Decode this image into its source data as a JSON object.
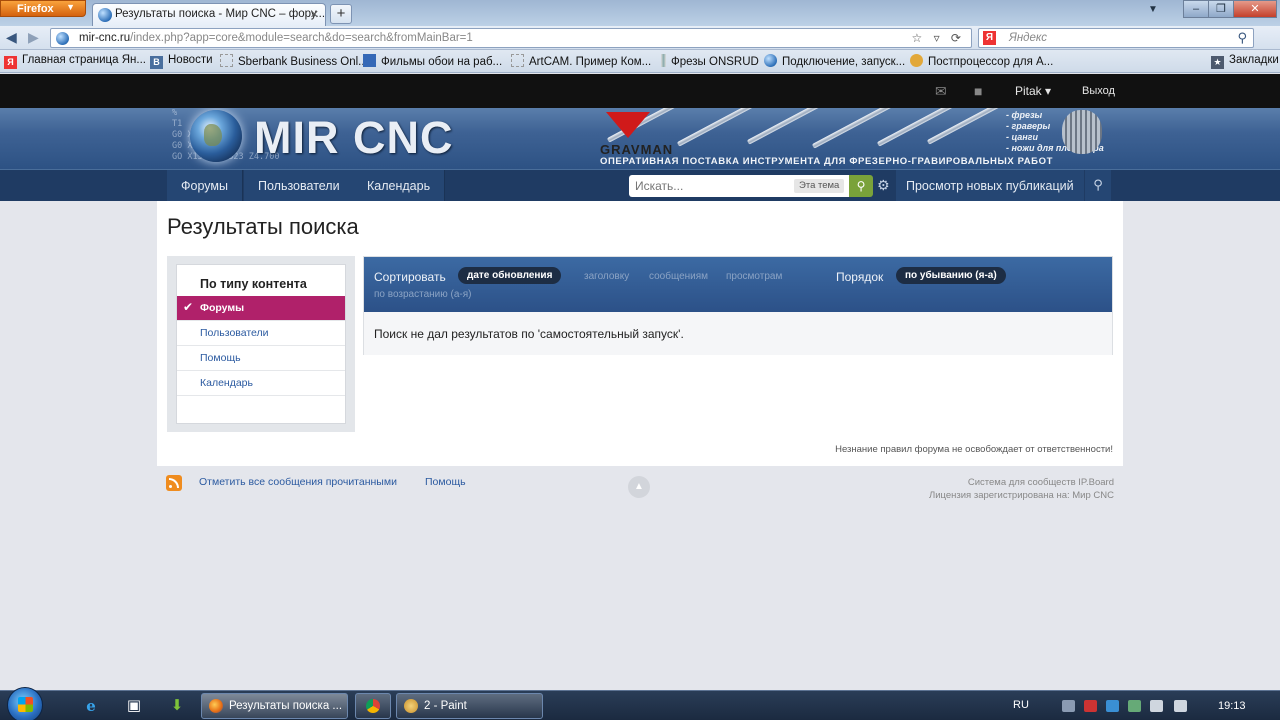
{
  "browser": {
    "firefox_button": "Firefox",
    "tab_title": "Результаты поиска - Мир CNC – фору...",
    "url_host": "mir-cnc.ru",
    "url_rest": "/index.php?app=core&module=search&do=search&fromMainBar=1",
    "search_placeholder": "Яндекс",
    "bookmarks": [
      "Главная страница Ян...",
      "Новости",
      "Sberbank Business Onl...",
      "Фильмы обои на раб...",
      "ArtCAM. Пример Ком...",
      "Фрезы ONSRUD",
      "Подключение, запуск...",
      "Постпроцессор для А..."
    ],
    "bookmarks_menu": "Закладки"
  },
  "site": {
    "user_name": "Pitak",
    "logout": "Выход",
    "logo_text": "MIR CNC",
    "gcode_lines": [
      "%",
      "T1",
      "G0 X0 Y0",
      "G0 X0 Y0",
      "GO X150 Y1.823 Z4.700"
    ],
    "banner_brand": "GRAVMAN",
    "banner_tagline": "ОПЕРАТИВНАЯ ПОСТАВКА ИНСТРУМЕНТА ДЛЯ ФРЕЗЕРНО-ГРАВИРОВАЛЬНЫХ РАБОТ",
    "banner_list": [
      "- фрезы",
      "- граверы",
      "- цанги",
      "- ножи для плоттера"
    ],
    "nav": {
      "forums": "Форумы",
      "users": "Пользователи",
      "calendar": "Календарь",
      "search_placeholder": "Искать...",
      "search_scope": "Эта тема",
      "view_new": "Просмотр новых публикаций"
    }
  },
  "main": {
    "title": "Результаты поиска",
    "sidebar": {
      "title": "По типу контента",
      "items": [
        "Форумы",
        "Пользователи",
        "Помощь",
        "Календарь"
      ],
      "active": "Форумы"
    },
    "sort": {
      "label": "Сортировать",
      "options": [
        "дате обновления",
        "заголовку",
        "сообщениям",
        "просмотрам"
      ],
      "active": "дате обновления",
      "order_label": "Порядок",
      "order_desc": "по убыванию (я-а)",
      "order_asc": "по возрастанию (а-я)"
    },
    "no_results": "Поиск не дал результатов по 'самостоятельный запуск'.",
    "disclaimer": "Незнание правил форума не освобождает от ответственности!"
  },
  "footer": {
    "mark_read": "Отметить все сообщения прочитанными",
    "help": "Помощь",
    "powered_by": "Система для сообществ IP.Board",
    "license": "Лицензия зарегистрирована на: Мир CNC"
  },
  "taskbar": {
    "firefox_task": "Результаты поиска ...",
    "paint_task": "2 - Paint",
    "language": "RU",
    "clock": "19:13"
  },
  "colors": {
    "accent_active": "#b0216a",
    "nav_bg": "#1f3b63",
    "search_button": "#7aa23a",
    "link": "#2b5aa0"
  }
}
